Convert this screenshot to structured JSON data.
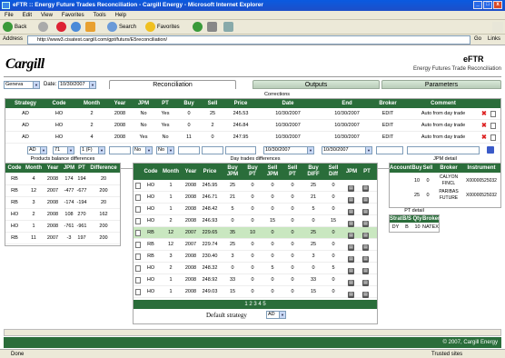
{
  "window": {
    "title": "eFTR :: Energy Future Trades Reconciliation - Cargill Energy - Microsoft Internet Explorer"
  },
  "menu": [
    "File",
    "Edit",
    "View",
    "Favorites",
    "Tools",
    "Help"
  ],
  "toolbar": {
    "back": "Back",
    "search": "Search",
    "favorites": "Favorites"
  },
  "address": {
    "label": "Address",
    "url": "http://www3.cisatest.cargill.com/gpt/futurs/E5reconciliation/",
    "go": "Go",
    "links": "Links"
  },
  "app": {
    "logo": "Cargill",
    "title": "eFTR",
    "subtitle": "Energy Futures Trade Reconciliation"
  },
  "filters": {
    "location": "Geneva",
    "date_label": "Date:",
    "date": "10/30/2007"
  },
  "tabs": [
    {
      "label": "Reconciliation",
      "active": true
    },
    {
      "label": "Outputs",
      "active": false
    },
    {
      "label": "Parameters",
      "active": false
    }
  ],
  "corrections": {
    "title": "Corrections",
    "headers": [
      "Strategy",
      "Code",
      "Month",
      "Year",
      "JPM",
      "PT",
      "Buy",
      "Sell",
      "Price",
      "Date",
      "End",
      "Broker",
      "Comment"
    ],
    "rows": [
      [
        "AD",
        "HO",
        "2",
        "2008",
        "No",
        "Yes",
        "0",
        "25",
        "245.53",
        "10/30/2007",
        "10/30/2007",
        "EDIT",
        "Auto from day trade"
      ],
      [
        "AD",
        "HO",
        "2",
        "2008",
        "No",
        "Yes",
        "0",
        "2",
        "246.84",
        "10/30/2007",
        "10/30/2007",
        "EDIT",
        "Auto from day trade"
      ],
      [
        "AD",
        "HO",
        "4",
        "2008",
        "Yes",
        "No",
        "11",
        "0",
        "247.95",
        "10/30/2007",
        "10/30/2007",
        "EDIT",
        "Auto from day trade"
      ]
    ],
    "new_row": {
      "strategy": "AD",
      "code": "71",
      "month": "1 (F)",
      "jpm": "No",
      "pt": "No",
      "date": "10/30/2007",
      "end": "10/30/2007"
    }
  },
  "positions": {
    "title": "Products balance differences",
    "headers": [
      "Code",
      "Month",
      "Year",
      "JPM",
      "PT",
      "Difference"
    ],
    "rows": [
      [
        "RB",
        "4",
        "2008",
        "174",
        "194",
        "20"
      ],
      [
        "RB",
        "12",
        "2007",
        "-477",
        "-677",
        "200"
      ],
      [
        "RB",
        "3",
        "2008",
        "-174",
        "-194",
        "20"
      ],
      [
        "HO",
        "2",
        "2008",
        "108",
        "270",
        "162"
      ],
      [
        "HO",
        "1",
        "2008",
        "-761",
        "-961",
        "200"
      ],
      [
        "RB",
        "11",
        "2007",
        "-3",
        "197",
        "200"
      ]
    ]
  },
  "daytrades": {
    "title": "Day trades differences",
    "headers": [
      "Code",
      "Month",
      "Year",
      "Price",
      "Buy JPM",
      "Buy PT",
      "Sell JPM",
      "Sell PT",
      "Buy DIFF",
      "Sell Diff",
      "JPM",
      "PT"
    ],
    "rows": [
      [
        "HO",
        "1",
        "2008",
        "245.95",
        "25",
        "0",
        "0",
        "0",
        "25",
        "0"
      ],
      [
        "HO",
        "1",
        "2008",
        "246.71",
        "21",
        "0",
        "0",
        "0",
        "21",
        "0"
      ],
      [
        "HO",
        "1",
        "2008",
        "248.42",
        "5",
        "0",
        "0",
        "0",
        "5",
        "0"
      ],
      [
        "HO",
        "2",
        "2008",
        "246.93",
        "0",
        "0",
        "15",
        "0",
        "0",
        "15"
      ],
      [
        "RB",
        "12",
        "2007",
        "229.65",
        "35",
        "10",
        "0",
        "0",
        "25",
        "0"
      ],
      [
        "RB",
        "12",
        "2007",
        "229.74",
        "25",
        "0",
        "0",
        "0",
        "25",
        "0"
      ],
      [
        "RB",
        "3",
        "2008",
        "230.40",
        "3",
        "0",
        "0",
        "0",
        "3",
        "0"
      ],
      [
        "HO",
        "2",
        "2008",
        "248.32",
        "0",
        "0",
        "5",
        "0",
        "0",
        "5"
      ],
      [
        "HO",
        "1",
        "2008",
        "248.92",
        "33",
        "0",
        "0",
        "0",
        "33",
        "0"
      ],
      [
        "HO",
        "1",
        "2008",
        "249.03",
        "15",
        "0",
        "0",
        "0",
        "15",
        "0"
      ]
    ],
    "pager": "1  2 3 4 5",
    "default_label": "Default strategy",
    "default_value": "AD"
  },
  "jpm_detail": {
    "title": "JPM detail",
    "headers": [
      "Account",
      "Buy",
      "Sell",
      "Broker",
      "Instrument"
    ],
    "rows": [
      [
        "",
        "10",
        "0",
        "CALYON FINCL",
        "X00000525032"
      ],
      [
        "",
        "25",
        "0",
        "PARIBAS FUTURE",
        "X00000525032"
      ]
    ]
  },
  "pt_detail": {
    "title": "PT detail",
    "headers": [
      "Strat",
      "B/S",
      "Qty",
      "Broker"
    ],
    "rows": [
      [
        "DY",
        "B",
        "10",
        "NATEX"
      ]
    ]
  },
  "footer": "© 2007, Cargill Energy",
  "status": {
    "left": "Done",
    "right": "Trusted sites"
  },
  "colors": {
    "header_green": "#2a6d3a",
    "highlight_row": "#c9e7c0",
    "title_blue": "#0a5ae0"
  }
}
